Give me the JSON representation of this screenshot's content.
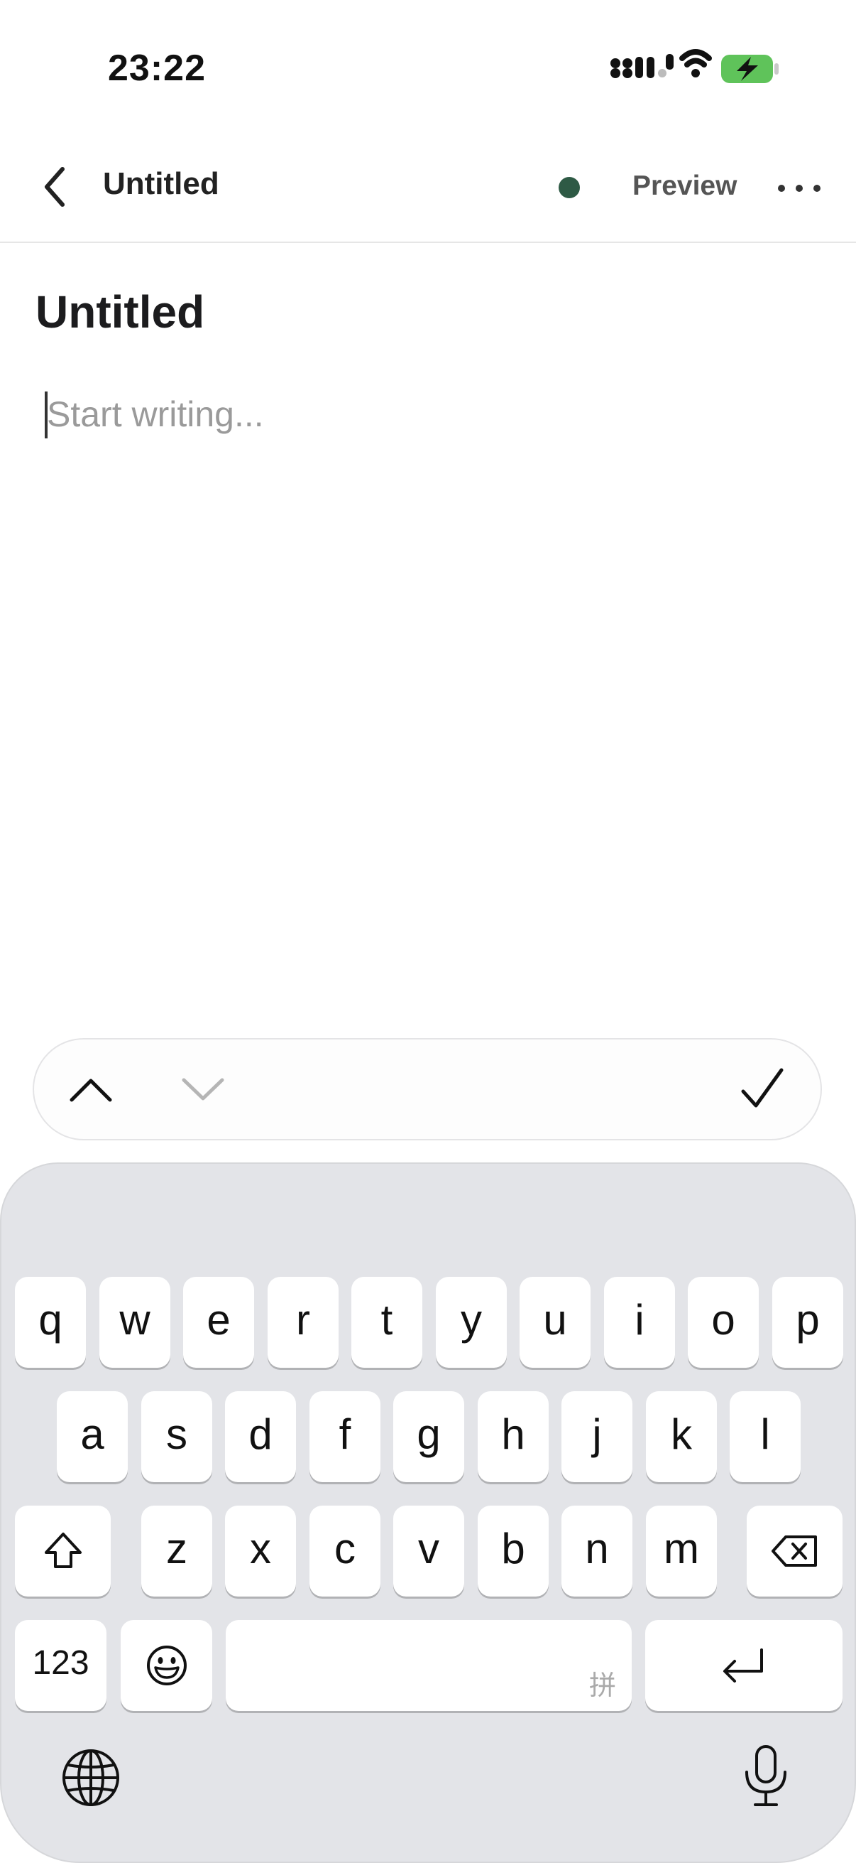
{
  "status_bar": {
    "time": "23:22",
    "signal_icon": "signal-icon",
    "wifi_icon": "wifi-icon",
    "battery_icon": "battery-charging-icon",
    "battery_color": "#5fc35a"
  },
  "nav": {
    "back_icon": "chevron-left-icon",
    "title": "Untitled",
    "sync_status_color": "#2e5a45",
    "preview_label": "Preview",
    "more_icon": "more-horizontal-icon"
  },
  "editor": {
    "title": "Untitled",
    "body_placeholder": "Start writing..."
  },
  "accessory_bar": {
    "up_icon": "chevron-up-icon",
    "down_icon": "chevron-down-icon",
    "done_icon": "checkmark-icon"
  },
  "keyboard": {
    "row1": [
      "q",
      "w",
      "e",
      "r",
      "t",
      "y",
      "u",
      "i",
      "o",
      "p"
    ],
    "row2": [
      "a",
      "s",
      "d",
      "f",
      "g",
      "h",
      "j",
      "k",
      "l"
    ],
    "row3": [
      "z",
      "x",
      "c",
      "v",
      "b",
      "n",
      "m"
    ],
    "shift_icon": "shift-icon",
    "delete_icon": "delete-backward-icon",
    "numbers_label": "123",
    "emoji_icon": "emoji-icon",
    "space_hint": "拼",
    "return_icon": "return-icon",
    "globe_icon": "globe-icon",
    "mic_icon": "microphone-icon"
  }
}
